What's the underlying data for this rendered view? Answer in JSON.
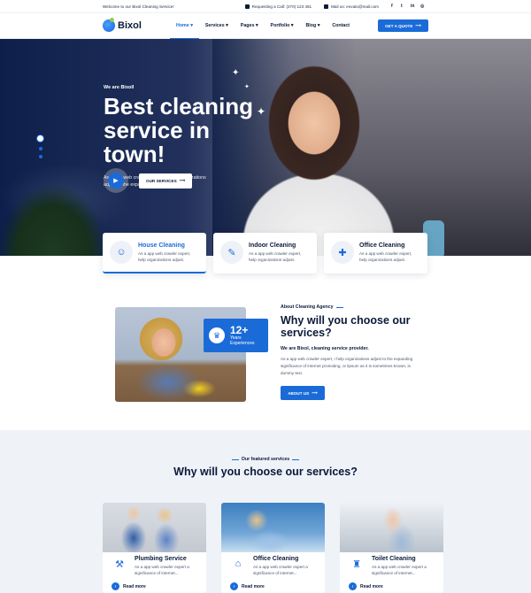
{
  "topbar": {
    "welcome": "Welcome to our Bixol Cleaning Service!",
    "call": "Requesting a Call: (270) 123 451",
    "mail": "Mail us: envato@mail.com",
    "social": [
      "f",
      "t",
      "in",
      "◎"
    ]
  },
  "nav": {
    "logo": "Bixol",
    "items": [
      "Home ▾",
      "Services ▾",
      "Pages ▾",
      "Portfolio ▾",
      "Blog ▾",
      "Contact"
    ],
    "cta": "GET A QUOTE",
    "arrow": "⟶"
  },
  "hero": {
    "kicker": "We are Bixoll",
    "title": "Best cleaning service in town!",
    "desc": "As a app web crawler expert, I help organizations adjust to the expanding significance.",
    "play": "▶",
    "button": "OUR SERVICES",
    "arrow": "⟶"
  },
  "service_cards": [
    {
      "icon": "☺",
      "title": "House Cleaning",
      "desc": "As a app web crawler expert, help organizations adjust."
    },
    {
      "icon": "✎",
      "title": "Indoor Cleaning",
      "desc": "As a app web crawler expert, help organizations adjust."
    },
    {
      "icon": "✚",
      "title": "Office Cleaning",
      "desc": "As a app web crawler expert, help organizations adjust."
    }
  ],
  "about": {
    "badge_icon": "♛",
    "badge_number": "12+",
    "badge_label": "Years Experiences",
    "kicker": "About Cleaning Agency",
    "title": "Why will you choose our services?",
    "subtitle": "We are Bixol, cleaning service provider.",
    "desc": "As a app web crawler expert, I help organizations adjust to the expanding significance of internet promoting, or lipsum as it is sometimes known, is dummy text.",
    "button": "ABOUT US",
    "arrow": "⟶"
  },
  "featured": {
    "kicker": "Our featured services",
    "title": "Why will you choose our services?",
    "cards": [
      {
        "icon": "⚒",
        "title": "Plumbing Service",
        "desc": "As a app web crawler expert a significance of internet...",
        "more": "Read more"
      },
      {
        "icon": "⌂",
        "title": "Office Cleaning",
        "desc": "As a app web crawler expert a significance of internet...",
        "more": "Read more"
      },
      {
        "icon": "♜",
        "title": "Toilet Cleaning",
        "desc": "As a app web crawler expert a significance of internet...",
        "more": "Read more"
      }
    ],
    "more_arrow": "›"
  },
  "colors": {
    "accent": "#1a6bd8",
    "dark": "#0b1a3a",
    "section_bg": "#eff2f7"
  }
}
